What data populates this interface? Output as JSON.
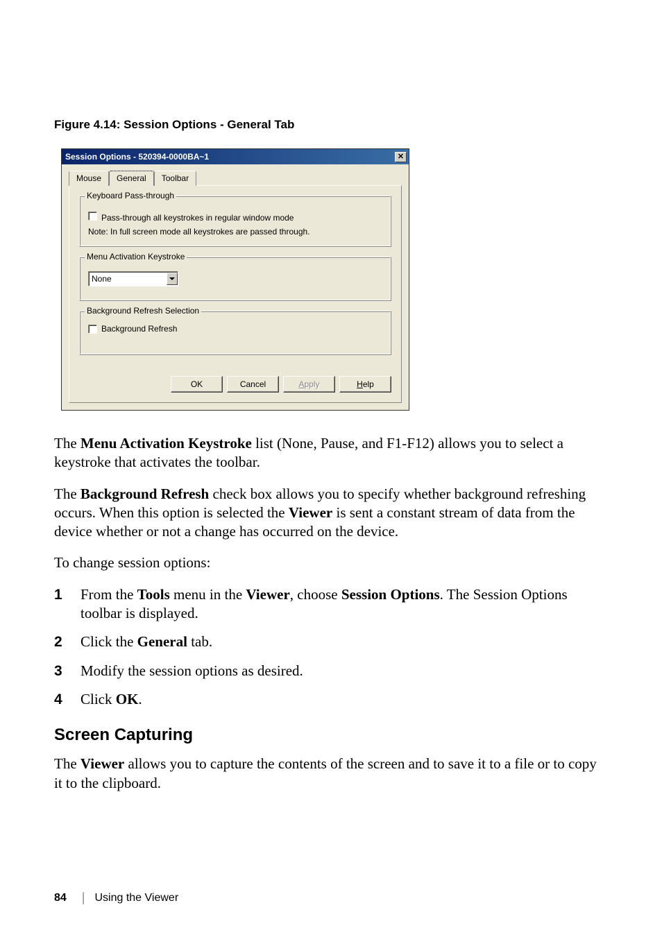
{
  "figure_caption": "Figure 4.14: Session Options - General Tab",
  "dialog": {
    "title": "Session Options - 520394-0000BA~1",
    "close_x": "✕",
    "tabs": {
      "mouse": "Mouse",
      "general": "General",
      "toolbar": "Toolbar"
    },
    "group1": {
      "title": "Keyboard Pass-through",
      "chk_label": "Pass-through all keystrokes in regular window mode",
      "note": "Note: In full screen mode all keystrokes are passed through."
    },
    "group2": {
      "title": "Menu Activation Keystroke",
      "combo_value": "None"
    },
    "group3": {
      "title": "Background Refresh Selection",
      "chk_label": "Background Refresh"
    },
    "buttons": {
      "ok": "OK",
      "cancel": "Cancel",
      "apply_pre": "A",
      "apply_post": "pply",
      "help_pre": "H",
      "help_post": "elp"
    }
  },
  "p1": {
    "t1": "The ",
    "b1": "Menu Activation Keystroke",
    "t2": " list (None, Pause, and F1-F12) allows you to select a keystroke that activates the toolbar."
  },
  "p2": {
    "t1": "The ",
    "b1": "Background Refresh",
    "t2": " check box allows you to specify whether background refreshing occurs. When this option is selected the ",
    "b2": "Viewer",
    "t3": " is sent a constant stream of data from the device whether or not a change has occurred on the device."
  },
  "p3": "To change session options:",
  "steps": {
    "n1": "1",
    "s1_t1": "From the ",
    "s1_b1": "Tools",
    "s1_t2": " menu in the ",
    "s1_b2": "Viewer",
    "s1_t3": ", choose ",
    "s1_b3": "Session Options",
    "s1_t4": ". The Session Options toolbar is displayed.",
    "n2": "2",
    "s2_t1": "Click the ",
    "s2_b1": "General",
    "s2_t2": " tab.",
    "n3": "3",
    "s3": "Modify the session options as desired.",
    "n4": "4",
    "s4_t1": "Click ",
    "s4_b1": "OK",
    "s4_t2": "."
  },
  "h2": "Screen Capturing",
  "p4": {
    "t1": "The ",
    "b1": "Viewer",
    "t2": " allows you to capture the contents of the screen and to save it to a file or to copy it to the clipboard."
  },
  "footer": {
    "page": "84",
    "section": "Using the Viewer"
  }
}
